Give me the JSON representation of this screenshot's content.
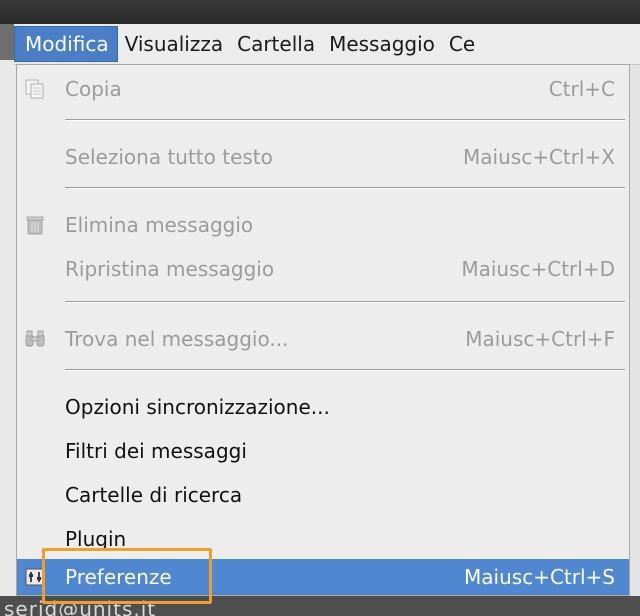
{
  "menubar": {
    "items": [
      {
        "label": "Modifica",
        "active": true
      },
      {
        "label": "Visualizza"
      },
      {
        "label": "Cartella"
      },
      {
        "label": "Messaggio"
      },
      {
        "label": "Ce"
      }
    ]
  },
  "menu": {
    "items": [
      {
        "label": "Copia",
        "accel": "Ctrl+C",
        "enabled": false,
        "icon": "copy-icon"
      },
      {
        "label": "Seleziona tutto testo",
        "accel": "Maiusc+Ctrl+X",
        "enabled": false
      },
      {
        "label": "Elimina messaggio",
        "accel": "",
        "enabled": false,
        "icon": "trash-icon"
      },
      {
        "label": "Ripristina messaggio",
        "accel": "Maiusc+Ctrl+D",
        "enabled": false
      },
      {
        "label": "Trova nel messaggio...",
        "accel": "Maiusc+Ctrl+F",
        "enabled": false,
        "icon": "binoculars-icon"
      },
      {
        "label": "Opzioni sincronizzazione...",
        "accel": "",
        "enabled": true
      },
      {
        "label": "Filtri dei messaggi",
        "accel": "",
        "enabled": true
      },
      {
        "label": "Cartelle di ricerca",
        "accel": "",
        "enabled": true
      },
      {
        "label": "Plugin",
        "accel": "",
        "enabled": true
      },
      {
        "label": "Preferenze",
        "accel": "Maiusc+Ctrl+S",
        "enabled": true,
        "highlighted": true,
        "icon": "preferences-icon"
      }
    ]
  },
  "background": {
    "status_text": "serid@units.it"
  },
  "colors": {
    "highlight": "#4f87d1",
    "focus_box": "#f0a02a",
    "disabled_text": "#9b9b9b"
  }
}
